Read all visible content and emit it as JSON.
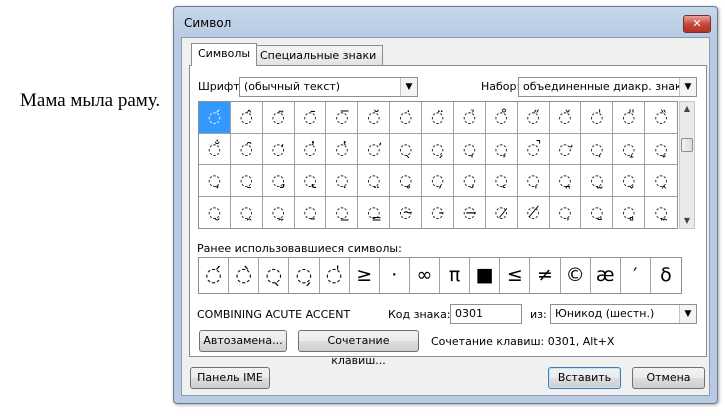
{
  "document": {
    "text": "Мама мыла раму."
  },
  "dialog": {
    "title": "Символ",
    "close_label": "✕",
    "tabs": [
      {
        "label": "Символы",
        "active": true
      },
      {
        "label": "Специальные знаки",
        "active": false
      }
    ],
    "font": {
      "label": "Шрифт:",
      "value": "(обычный текст)"
    },
    "subset": {
      "label": "Набор:",
      "value": "объединенные диакр. знаки"
    },
    "grid": [
      [
        "◌́",
        "◌̂",
        "◌̃",
        "◌̄",
        "◌̅",
        "◌̆",
        "◌̇",
        "◌̈",
        "◌̉",
        "◌̊",
        "◌̋",
        "◌̌",
        "◌̍",
        "◌̎",
        "◌̏"
      ],
      [
        "◌̐",
        "◌̑",
        "◌̒",
        "◌̓",
        "◌̔",
        "◌̕",
        "◌̖",
        "◌̗",
        "◌̘",
        "◌̙",
        "◌̚",
        "◌̛",
        "◌̜",
        "◌̝",
        "◌̞"
      ],
      [
        "◌̟",
        "◌̠",
        "◌̡",
        "◌̢",
        "◌̣",
        "◌̤",
        "◌̥",
        "◌̦",
        "◌̧",
        "◌̨",
        "◌̩",
        "◌̪",
        "◌̫",
        "◌̬",
        "◌̭"
      ],
      [
        "◌̮",
        "◌̯",
        "◌̰",
        "◌̱",
        "◌̲",
        "◌̳",
        "◌̴",
        "◌̵",
        "◌̶",
        "◌̷",
        "◌̸",
        "◌̹",
        "◌̺",
        "◌̻",
        "◌̼"
      ]
    ],
    "recent_label": "Ранее использовавшиеся символы:",
    "recent": [
      "◌́",
      "◌̀",
      "◌̖",
      "◌̗",
      "◌̍",
      "≥",
      "·",
      "∞",
      "π",
      "■",
      "≤",
      "≠",
      "©",
      "æ",
      "′",
      "δ"
    ],
    "char_name": "COMBINING ACUTE ACCENT",
    "code": {
      "label": "Код знака:",
      "value": "0301"
    },
    "from": {
      "label": "из:",
      "value": "Юникод (шестн.)"
    },
    "autocorrect_button": "Автозамена...",
    "shortcut_button": "Сочетание клавиш...",
    "shortcut_text": "Сочетание клавиш: 0301, Alt+X",
    "ime_button": "Панель IME",
    "insert_button": "Вставить",
    "cancel_button": "Отмена"
  }
}
